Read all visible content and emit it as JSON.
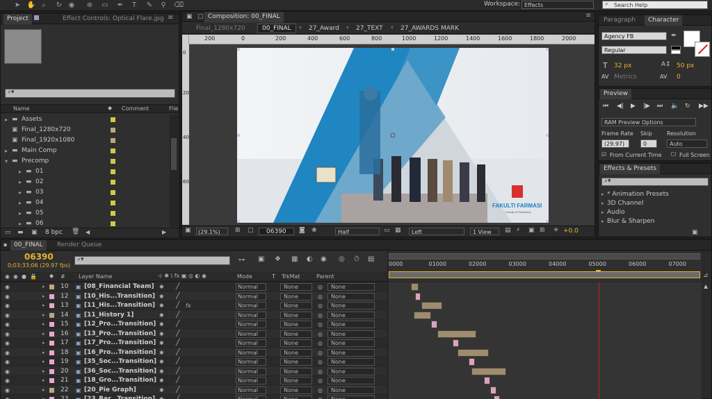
{
  "toolbar": {
    "workspace_label": "Workspace:",
    "workspace_value": "Effects",
    "search_placeholder": "Search Help"
  },
  "project_panel": {
    "tabs": [
      {
        "label": "Project"
      },
      {
        "label": "Effect Controls: Optical Flare.jpg"
      }
    ],
    "columns": {
      "name": "Name",
      "comment": "Comment",
      "file": "File"
    },
    "items": [
      {
        "name": "Assets",
        "type": "folder",
        "color": "#d4c84a"
      },
      {
        "name": "Final_1280x720",
        "type": "comp",
        "color": "#bda77d"
      },
      {
        "name": "Final_1920x1080",
        "type": "comp",
        "color": "#bda77d"
      },
      {
        "name": "Main Comp",
        "type": "folder",
        "color": "#d4c84a"
      },
      {
        "name": "Precomp",
        "type": "folder",
        "color": "#d4c84a"
      },
      {
        "name": "01",
        "type": "folder",
        "color": "#d4c84a"
      },
      {
        "name": "02",
        "type": "folder",
        "color": "#d4c84a"
      },
      {
        "name": "03",
        "type": "folder",
        "color": "#d4c84a"
      },
      {
        "name": "04",
        "type": "folder",
        "color": "#d4c84a"
      },
      {
        "name": "05",
        "type": "folder",
        "color": "#d4c84a"
      },
      {
        "name": "06",
        "type": "folder",
        "color": "#d4c84a"
      }
    ],
    "bpc_label": "8 bpc"
  },
  "composition_panel": {
    "tab_label": "Composition: 00_FINAL",
    "breadcrumbs": [
      "Final_1280x720",
      "00_FINAL",
      "27_Award",
      "27_TEXT",
      "27_AWARDS MARK"
    ],
    "ruler_ticks": [
      "200",
      "0",
      "200",
      "400",
      "600",
      "800",
      "1000",
      "1200",
      "1400",
      "1600",
      "1800",
      "2000"
    ],
    "vruler_ticks": [
      "0",
      "200",
      "400",
      "600"
    ],
    "logo_text": "FAKULTI FARMASI",
    "logo_sub": "Faculty of Pharmacy",
    "bottom_bar": {
      "zoom": "(29.1%)",
      "timecode": "06390",
      "resolution": "Half",
      "view": "Left",
      "views": "1 View",
      "exposure": "+0.0"
    }
  },
  "character_panel": {
    "tabs": [
      {
        "label": "Paragraph"
      },
      {
        "label": "Character"
      }
    ],
    "font": "Agency FB",
    "style": "Regular",
    "size": "32 px",
    "leading": "50 px",
    "kerning": "Metrics",
    "tracking": "0"
  },
  "preview_panel": {
    "title": "Preview",
    "ram_preview": "RAM Preview Options",
    "frame_rate_label": "Frame Rate",
    "skip_label": "Skip",
    "resolution_label": "Resolution",
    "frame_rate": "(29.97)",
    "skip": "0",
    "resolution": "Auto",
    "from_current": "From Current Time",
    "full_screen": "Full Screen"
  },
  "effects_panel": {
    "title": "Effects & Presets",
    "items": [
      "* Animation Presets",
      "3D Channel",
      "Audio",
      "Blur & Sharpen"
    ]
  },
  "timeline": {
    "tabs": [
      {
        "label": "00_FINAL"
      },
      {
        "label": "Render Queue"
      }
    ],
    "timecode": "06390",
    "timecode_sub": "0;03;33;06 (29.97 fps)",
    "columns": {
      "label": "#",
      "name": "Layer Name",
      "mode": "Mode",
      "t": "T",
      "trkmat": "TrkMat",
      "parent": "Parent"
    },
    "ruler": [
      "0000",
      "01000",
      "02000",
      "03000",
      "04000",
      "05000",
      "06000",
      "07000"
    ],
    "layers": [
      {
        "num": "10",
        "name": "[08_Financial Team]",
        "color": "#bda77d",
        "fx": false,
        "mode": "Normal",
        "trkmat": "None",
        "parent": "None",
        "start": 0.07,
        "dur": 0.025,
        "pink": false
      },
      {
        "num": "12",
        "name": "[10_His...Transition]",
        "color": "#e8a9c9",
        "fx": false,
        "mode": "Normal",
        "trkmat": "None",
        "parent": "None",
        "start": 0.085,
        "dur": 0.018,
        "pink": true
      },
      {
        "num": "13",
        "name": "[11_His...Transition]",
        "color": "#e8a9c9",
        "fx": true,
        "mode": "Normal",
        "trkmat": "None",
        "parent": "None",
        "start": 0.105,
        "dur": 0.065,
        "pink": false
      },
      {
        "num": "14",
        "name": "[11_History 1]",
        "color": "#bda77d",
        "fx": false,
        "mode": "Normal",
        "trkmat": "None",
        "parent": "None",
        "start": 0.08,
        "dur": 0.055,
        "pink": false
      },
      {
        "num": "15",
        "name": "[12_Pro...Transition]",
        "color": "#e8a9c9",
        "fx": false,
        "mode": "Normal",
        "trkmat": "None",
        "parent": "None",
        "start": 0.135,
        "dur": 0.02,
        "pink": true
      },
      {
        "num": "16",
        "name": "[13_Pro...Transition]",
        "color": "#e8a9c9",
        "fx": false,
        "mode": "Normal",
        "trkmat": "None",
        "parent": "None",
        "start": 0.155,
        "dur": 0.125,
        "pink": false
      },
      {
        "num": "17",
        "name": "[17_Pro...Transition]",
        "color": "#e8a9c9",
        "fx": false,
        "mode": "Normal",
        "trkmat": "None",
        "parent": "None",
        "start": 0.205,
        "dur": 0.02,
        "pink": true
      },
      {
        "num": "18",
        "name": "[16_Pro...Transition]",
        "color": "#e8a9c9",
        "fx": false,
        "mode": "Normal",
        "trkmat": "None",
        "parent": "None",
        "start": 0.22,
        "dur": 0.1,
        "pink": false
      },
      {
        "num": "19",
        "name": "[35_Soc...Transition]",
        "color": "#e8a9c9",
        "fx": false,
        "mode": "Normal",
        "trkmat": "None",
        "parent": "None",
        "start": 0.255,
        "dur": 0.02,
        "pink": true
      },
      {
        "num": "20",
        "name": "[36_Soc...Transition]",
        "color": "#e8a9c9",
        "fx": false,
        "mode": "Normal",
        "trkmat": "None",
        "parent": "None",
        "start": 0.265,
        "dur": 0.11,
        "pink": false
      },
      {
        "num": "21",
        "name": "[18_Gro...Transition]",
        "color": "#e8a9c9",
        "fx": false,
        "mode": "Normal",
        "trkmat": "None",
        "parent": "None",
        "start": 0.305,
        "dur": 0.02,
        "pink": true
      },
      {
        "num": "22",
        "name": "[20_Pie Graph]",
        "color": "#bda77d",
        "fx": false,
        "mode": "Normal",
        "trkmat": "None",
        "parent": "None",
        "start": 0.325,
        "dur": 0.02,
        "pink": true
      },
      {
        "num": "23",
        "name": "[23_Bar...Transition]",
        "color": "#e8a9c9",
        "fx": false,
        "mode": "Normal",
        "trkmat": "None",
        "parent": "None",
        "start": 0.335,
        "dur": 0.02,
        "pink": true
      }
    ],
    "playhead": 0.67
  }
}
